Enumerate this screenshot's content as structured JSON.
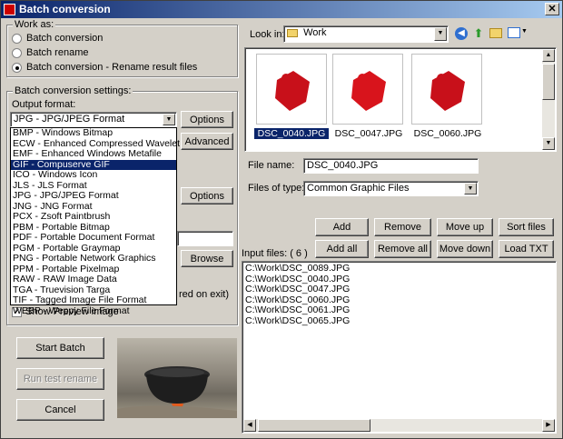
{
  "window": {
    "title": "Batch conversion"
  },
  "work_as": {
    "label": "Work as:",
    "options": [
      "Batch conversion",
      "Batch rename",
      "Batch conversion - Rename result files"
    ],
    "selected": 2
  },
  "settings": {
    "label": "Batch conversion settings:",
    "output_format_label": "Output format:",
    "output_format_value": "JPG - JPG/JPEG Format",
    "options_button": "Options",
    "advanced_button": "Advanced",
    "options_button_2": "Options",
    "browse_button": "Browse",
    "tail_text": "red on exit)",
    "show_preview_label": "Show Preview image"
  },
  "format_list": {
    "items": [
      "BMP - Windows Bitmap",
      "ECW - Enhanced Compressed Wavelet",
      "EMF - Enhanced Windows Metafile",
      "GIF - Compuserve GIF",
      "ICO - Windows Icon",
      "JLS - JLS Format",
      "JPG - JPG/JPEG Format",
      "JNG - JNG Format",
      "PCX - Zsoft Paintbrush",
      "PBM - Portable Bitmap",
      "PDF - Portable Document Format",
      "PGM - Portable Graymap",
      "PNG - Portable Network Graphics",
      "PPM - Portable Pixelmap",
      "RAW - RAW Image Data",
      "TGA - Truevision Targa",
      "TIF - Tagged Image File Format",
      "WEBP - Weppy File Format"
    ],
    "selected": 3
  },
  "actions": {
    "start_batch": "Start Batch",
    "run_test_rename": "Run test rename",
    "cancel": "Cancel"
  },
  "browser": {
    "look_in_label": "Look in:",
    "look_in_value": "Work",
    "thumbnails": [
      "DSC_0040.JPG",
      "DSC_0047.JPG",
      "DSC_0060.JPG"
    ],
    "file_name_label": "File name:",
    "file_name_value": "DSC_0040.JPG",
    "files_of_type_label": "Files of type:",
    "files_of_type_value": "Common Graphic Files"
  },
  "list_buttons": {
    "add": "Add",
    "remove": "Remove",
    "move_up": "Move up",
    "sort_files": "Sort files",
    "add_all": "Add all",
    "remove_all": "Remove all",
    "move_down": "Move down",
    "load_txt": "Load TXT"
  },
  "input_files": {
    "label": "Input files: ( 6 )",
    "items": [
      "C:\\Work\\DSC_0089.JPG",
      "C:\\Work\\DSC_0040.JPG",
      "C:\\Work\\DSC_0047.JPG",
      "C:\\Work\\DSC_0060.JPG",
      "C:\\Work\\DSC_0061.JPG",
      "C:\\Work\\DSC_0065.JPG"
    ]
  }
}
